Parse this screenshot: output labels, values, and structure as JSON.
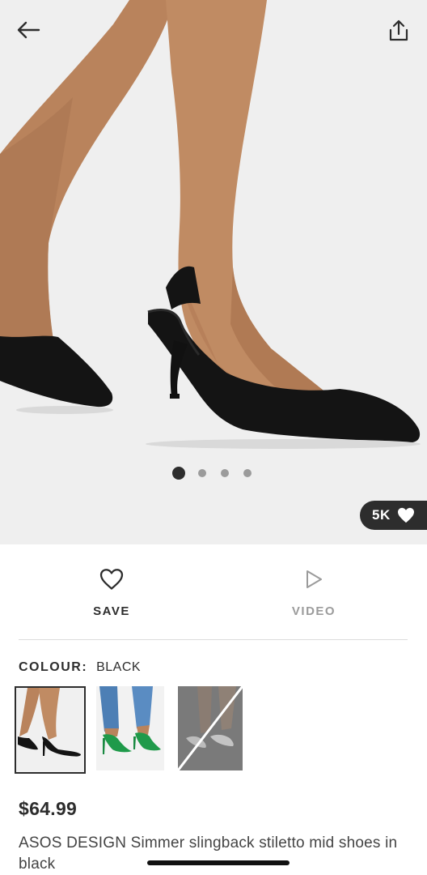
{
  "header": {
    "back_icon": "arrow-left-icon",
    "share_icon": "share-icon"
  },
  "gallery": {
    "image_count": 4,
    "active_index": 0,
    "likes_label": "5K",
    "likes_icon": "heart-filled-icon"
  },
  "actions": {
    "save_label": "SAVE",
    "save_icon": "heart-outline-icon",
    "video_label": "VIDEO",
    "video_icon": "play-outline-icon"
  },
  "colour": {
    "label": "COLOUR:",
    "value": "BLACK",
    "swatches": [
      {
        "name": "black",
        "selected": true
      },
      {
        "name": "green",
        "selected": false
      },
      {
        "name": "silver",
        "selected": false,
        "unavailable": true
      }
    ]
  },
  "product": {
    "price": "$64.99",
    "name": "ASOS DESIGN Simmer slingback stiletto mid shoes in black"
  },
  "colors": {
    "text": "#2d2d2d",
    "muted": "#9b9b9b",
    "pill_bg": "#2d2d2d",
    "background": "#ffffff"
  }
}
